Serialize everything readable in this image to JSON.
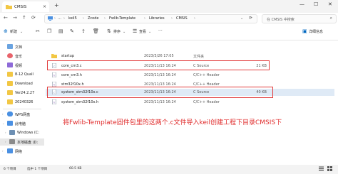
{
  "window": {
    "tab_title": "CMSIS",
    "tab_close": "×",
    "new_tab": "+",
    "controls": {
      "min": "—",
      "max": "☐",
      "close": "✕"
    }
  },
  "nav": {
    "back": "←",
    "forward": "→",
    "up": "↑",
    "refresh": "⟳"
  },
  "breadcrumb": [
    {
      "label": "…"
    },
    {
      "label": "keil5"
    },
    {
      "label": "Zcode"
    },
    {
      "label": "Fwlib-Template"
    },
    {
      "label": "Libraries"
    },
    {
      "label": "CMSIS"
    }
  ],
  "breadcrumb_sep": "›",
  "search": {
    "placeholder": "在 CMSIS 中搜索",
    "icon": "search-icon"
  },
  "toolbar": {
    "new_label": "新建",
    "sort_label": "排序",
    "view_label": "查看",
    "more": "···",
    "details_label": "详细信息"
  },
  "sidebar": {
    "items": [
      {
        "label": "文档",
        "icon": "document-icon",
        "color": "#6aa3e0"
      },
      {
        "label": "音乐",
        "icon": "music-icon",
        "color": "#e8636b"
      },
      {
        "label": "视频",
        "icon": "video-icon",
        "color": "#8e6ad8"
      },
      {
        "label": "8-12 Quall",
        "icon": "folder-icon",
        "color": "#f2c744"
      },
      {
        "label": "Download",
        "icon": "folder-icon",
        "color": "#f2c744"
      },
      {
        "label": "Ver24.2.27",
        "icon": "folder-icon",
        "color": "#f2c744"
      },
      {
        "label": "20240326",
        "icon": "folder-icon",
        "color": "#f2c744"
      },
      {
        "label": "WPS网盘",
        "icon": "cloud-icon",
        "color": "#4a90e2"
      },
      {
        "label": "此电脑",
        "icon": "computer-icon",
        "color": "#4a90e2"
      },
      {
        "label": "Windows (C:",
        "icon": "drive-icon",
        "color": "#6d8fb3"
      },
      {
        "label": "本地磁盘 (D:",
        "icon": "drive-icon",
        "color": "#8a8a8a"
      },
      {
        "label": "网络",
        "icon": "network-icon",
        "color": "#4a90e2"
      }
    ]
  },
  "files": [
    {
      "name": "startup",
      "date": "2023/3/26 17:05",
      "type": "文件夹",
      "size": "",
      "kind": "folder"
    },
    {
      "name": "core_cm3.c",
      "date": "2023/11/13 16:24",
      "type": "C Source",
      "size": "21 KB",
      "kind": "c"
    },
    {
      "name": "core_cm3.h",
      "date": "2023/11/13 16:24",
      "type": "C/C++ Header",
      "size": "",
      "kind": "h"
    },
    {
      "name": "stm32f10x.h",
      "date": "2023/11/13 16:24",
      "type": "C/C++ Header",
      "size": "",
      "kind": "h"
    },
    {
      "name": "system_stm32f10x.c",
      "date": "2023/11/13 16:24",
      "type": "C Source",
      "size": "40 KB",
      "kind": "c"
    },
    {
      "name": "system_stm32f10x.h",
      "date": "2023/11/13 16:24",
      "type": "C/C++ Header",
      "size": "",
      "kind": "h"
    }
  ],
  "annotation": "将Fwlib-Template固件包里的这两个.c文件导入keil创建工程下目录CMSIS下",
  "status": {
    "count": "6 个项目",
    "selected": "选中 1 个项目",
    "size": "60.5 KB"
  },
  "colors": {
    "accent": "#0067c0",
    "highlight_box": "#e23c3c",
    "folder": "#f2c744",
    "selected_row": "#dfeaf6"
  }
}
